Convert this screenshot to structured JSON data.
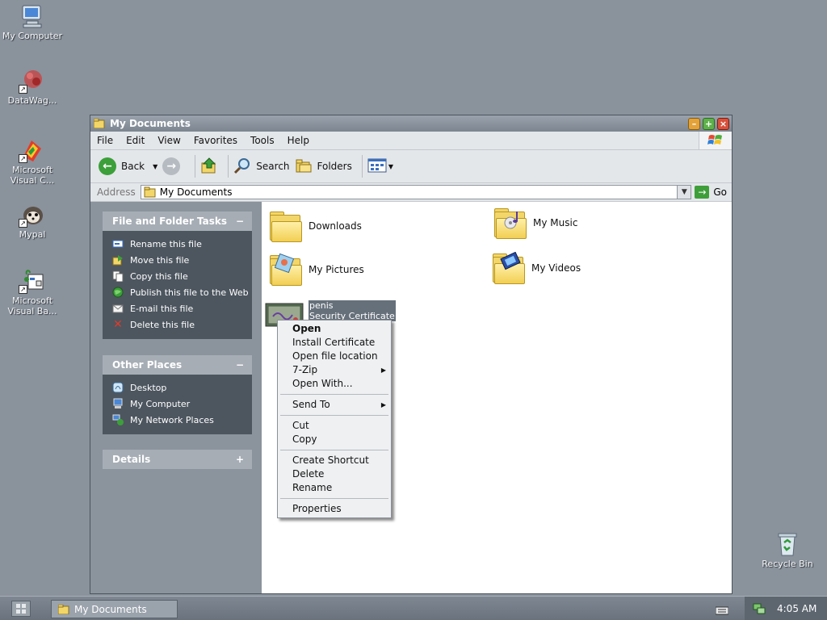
{
  "desktop": {
    "icons": [
      {
        "label": "My Computer",
        "icon": "computer-icon"
      },
      {
        "label": "DataWag...",
        "icon": "datawag-icon"
      },
      {
        "label": "Microsoft Visual C...",
        "icon": "visual-c-icon"
      },
      {
        "label": "Mypal",
        "icon": "mypal-icon"
      },
      {
        "label": "Microsoft Visual Ba...",
        "icon": "visual-basic-icon"
      },
      {
        "label": "Recycle Bin",
        "icon": "recycle-bin-icon"
      }
    ]
  },
  "window": {
    "title": "My Documents",
    "menu": [
      "File",
      "Edit",
      "View",
      "Favorites",
      "Tools",
      "Help"
    ],
    "toolbar": {
      "back": "Back",
      "search": "Search",
      "folders": "Folders"
    },
    "address": {
      "label": "Address",
      "value": "My Documents",
      "go": "Go"
    }
  },
  "tasks": {
    "file_folder": {
      "title": "File and Folder Tasks",
      "items": [
        "Rename this file",
        "Move this file",
        "Copy this file",
        "Publish this file to the Web",
        "E-mail this file",
        "Delete this file"
      ]
    },
    "other_places": {
      "title": "Other Places",
      "items": [
        "Desktop",
        "My Computer",
        "My Network Places"
      ]
    },
    "details": {
      "title": "Details"
    }
  },
  "files": [
    {
      "name": "Downloads"
    },
    {
      "name": "My Music"
    },
    {
      "name": "My Pictures"
    },
    {
      "name": "My Videos"
    },
    {
      "name": "penis",
      "type": "Security Certificate"
    }
  ],
  "context_menu": {
    "open": "Open",
    "install": "Install Certificate",
    "open_location": "Open file location",
    "seven_zip": "7-Zip",
    "open_with": "Open With...",
    "send_to": "Send To",
    "cut": "Cut",
    "copy": "Copy",
    "create_shortcut": "Create Shortcut",
    "delete": "Delete",
    "rename": "Rename",
    "properties": "Properties"
  },
  "taskbar": {
    "task": "My Documents",
    "clock": "4:05 AM"
  },
  "colors": {
    "desktop": "#8a929c",
    "panel_body": "#4d565f",
    "panel_header": "#a6adb5",
    "close_button": "#d8503b"
  }
}
